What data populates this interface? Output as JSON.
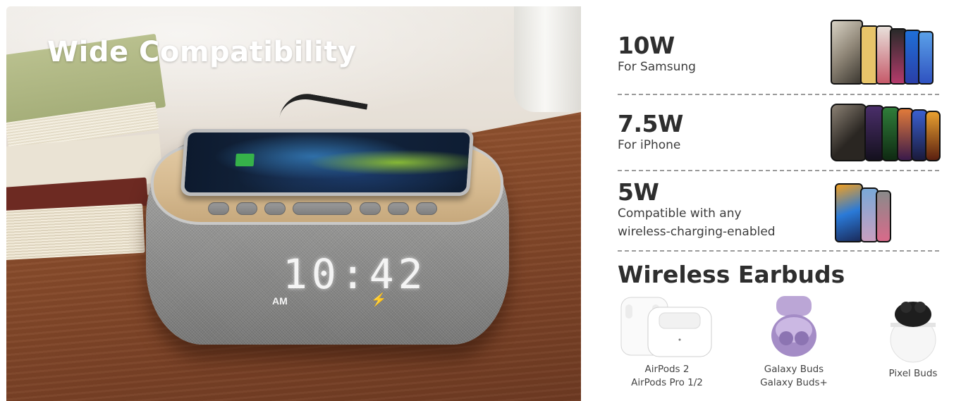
{
  "photo": {
    "title": "Wide Compatibility",
    "clock_time": "10:42",
    "clock_ampm": "AM"
  },
  "specs": [
    {
      "power": "10W",
      "line1": "For Samsung",
      "line2": ""
    },
    {
      "power": "7.5W",
      "line1": "For iPhone",
      "line2": ""
    },
    {
      "power": "5W",
      "line1": "Compatible with any",
      "line2": "wireless-charging-enabled"
    }
  ],
  "earbuds": {
    "title": "Wireless Earbuds",
    "items": [
      {
        "line1": "AirPods 2",
        "line2": "AirPods Pro 1/2"
      },
      {
        "line1": "Galaxy Buds",
        "line2": "Galaxy Buds+"
      },
      {
        "line1": "Pixel Buds",
        "line2": ""
      }
    ]
  }
}
